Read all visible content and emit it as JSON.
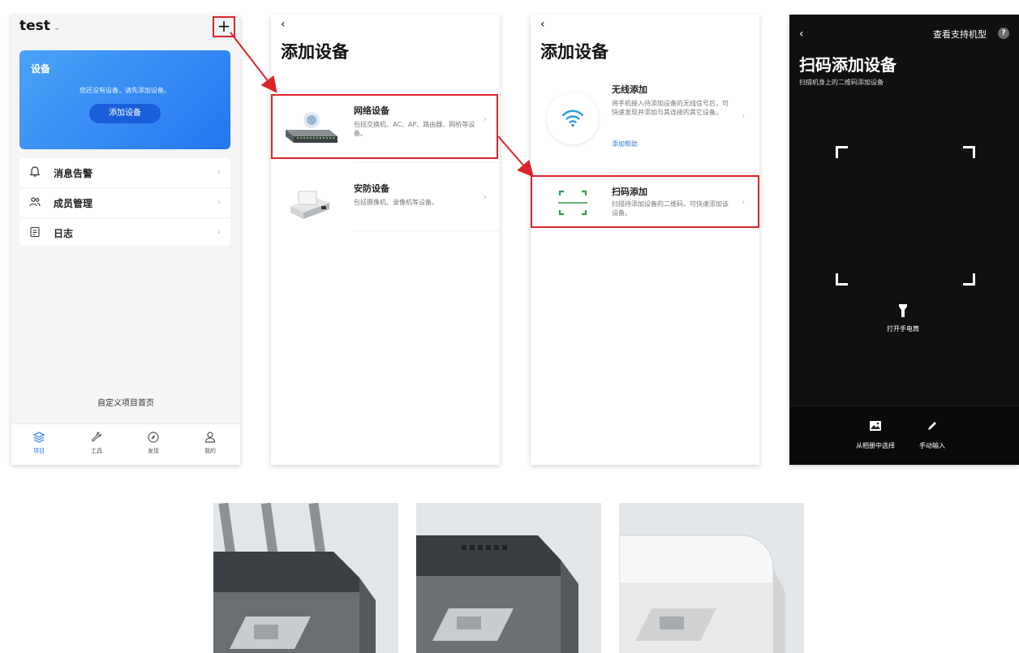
{
  "screen1": {
    "project_name": "test",
    "device_card": {
      "title": "设备",
      "message": "您还没有设备，请先添加设备。",
      "button": "添加设备"
    },
    "menu": [
      {
        "label": "消息告警",
        "icon": "bell-icon"
      },
      {
        "label": "成员管理",
        "icon": "members-icon"
      },
      {
        "label": "日志",
        "icon": "log-icon"
      }
    ],
    "custom_home": "自定义项目首页",
    "tabs": [
      {
        "label": "项目",
        "icon": "layers-icon",
        "active": true
      },
      {
        "label": "工具",
        "icon": "wrench-icon"
      },
      {
        "label": "发现",
        "icon": "compass-icon"
      },
      {
        "label": "我的",
        "icon": "user-icon"
      }
    ]
  },
  "screen2": {
    "title": "添加设备",
    "items": [
      {
        "name": "网络设备",
        "desc": "包括交换机、AC、AP、路由器、网桥等设备。"
      },
      {
        "name": "安防设备",
        "desc": "包括摄像机、录像机等设备。"
      }
    ]
  },
  "screen3": {
    "title": "添加设备",
    "wireless": {
      "name": "无线添加",
      "desc": "将手机接入待添加设备的无线信号后，可快速发现并添加与其连接的其它设备。",
      "help": "添加帮助"
    },
    "scan": {
      "name": "扫码添加",
      "desc": "扫描待添加设备的二维码，可快速添加该设备。"
    }
  },
  "screen4": {
    "supported_models": "查看支持机型",
    "help_mark": "?",
    "title": "扫码添加设备",
    "subtitle": "扫描机身上的二维码添加设备",
    "flashlight": "打开手电筒",
    "from_album": "从相册中选择",
    "manual_input": "手动输入"
  },
  "colors": {
    "accent_blue": "#2a7bf0",
    "highlight_red": "#d8262b",
    "scan_green": "#2e9e4f"
  }
}
